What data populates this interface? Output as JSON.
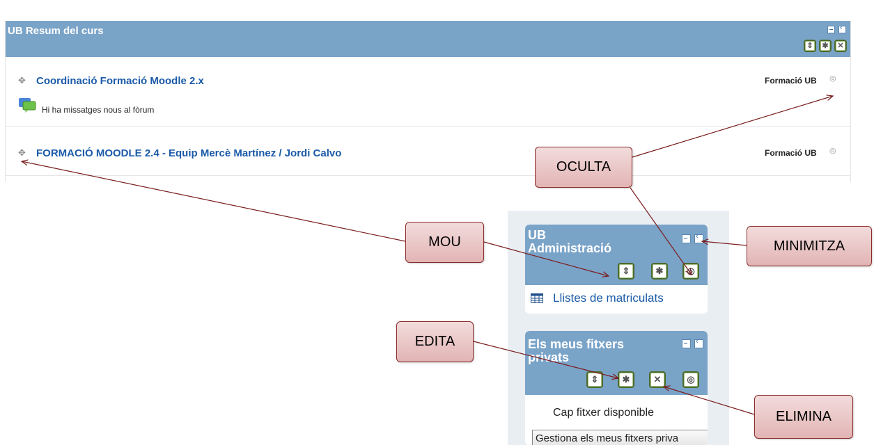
{
  "main_block": {
    "title": "UB Resum del curs",
    "courses": [
      {
        "name": "Coordinació Formació Moodle 2.x",
        "category": "Formació UB",
        "notice": "Hi ha missatges nous al fòrum"
      },
      {
        "name": "FORMACIÓ MOODLE 2.4 - Equip Mercè Martínez / Jordi Calvo",
        "category": "Formació UB"
      }
    ]
  },
  "side_blocks": {
    "admin": {
      "title_line1": "UB",
      "title_line2": "Administració",
      "link": "Llistes de matriculats"
    },
    "files": {
      "title_line1": "Els meus fitxers",
      "title_line2": "privats",
      "empty_text": "Cap fitxer disponible",
      "manage_button": "Gestiona els meus fitxers priva"
    }
  },
  "callouts": {
    "oculta": "OCULTA",
    "mou": "MOU",
    "minimitza": "MINIMITZA",
    "edita": "EDITA",
    "elimina": "ELIMINA"
  },
  "colors": {
    "header_blue": "#7aa3c8",
    "link_blue": "#1a5aa8",
    "callout_border": "#8b2a2a",
    "arrow": "#7a1e1e"
  },
  "icons": [
    "move-icon",
    "edit-icon",
    "delete-icon",
    "hide-icon",
    "minimize-icon",
    "dock-icon",
    "forum-icon",
    "table-icon",
    "eye-icon"
  ]
}
